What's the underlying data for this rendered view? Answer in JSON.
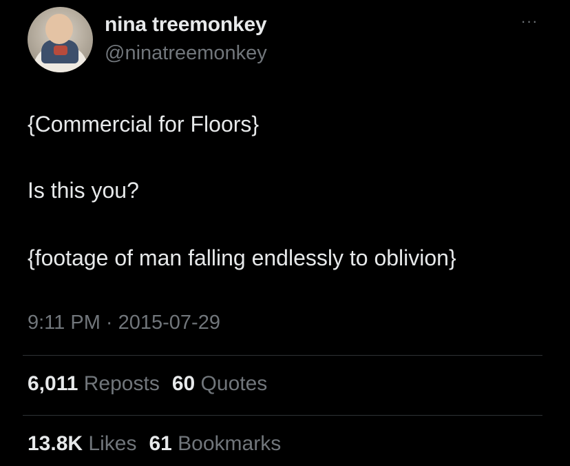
{
  "author": {
    "display_name": "nina treemonkey",
    "handle": "@ninatreemonkey",
    "avatar_icon": "baby-photo-avatar"
  },
  "more_icon": "more-horizontal-icon",
  "more_glyph": "···",
  "tweet": {
    "lines": [
      "{Commercial for Floors}",
      "Is this you?",
      "{footage of man falling endlessly to oblivion}"
    ],
    "timestamp": "9:11 PM · 2015-07-29"
  },
  "stats": {
    "reposts_count": "6,011",
    "reposts_label": "Reposts",
    "quotes_count": "60",
    "quotes_label": "Quotes",
    "likes_count": "13.8K",
    "likes_label": "Likes",
    "bookmarks_count": "61",
    "bookmarks_label": "Bookmarks"
  },
  "colors": {
    "background": "#000000",
    "primary_text": "#e7e9ea",
    "secondary_text": "#71767b",
    "divider": "#2f3336"
  }
}
